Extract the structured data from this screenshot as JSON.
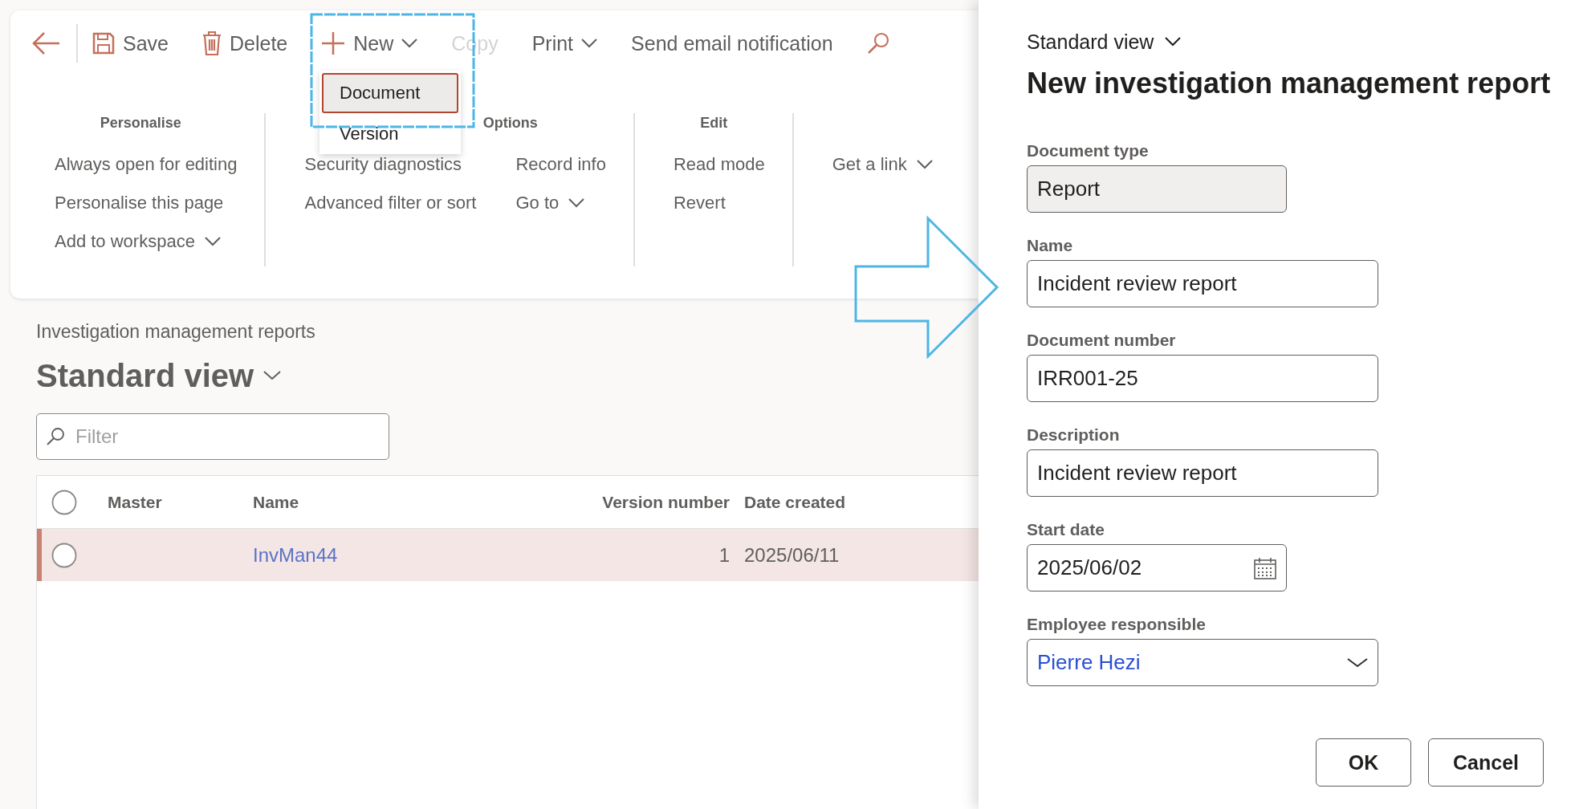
{
  "toolbar": {
    "items": [
      {
        "kind": "back",
        "disabled": false
      },
      {
        "kind": "save",
        "label": "Save",
        "disabled": false
      },
      {
        "kind": "delete",
        "label": "Delete",
        "disabled": false
      },
      {
        "kind": "new",
        "label": "New",
        "dropdown": true,
        "disabled": false
      },
      {
        "kind": "plain",
        "label": "Copy",
        "dropdown": false,
        "disabled": true
      },
      {
        "kind": "plain",
        "label": "Print",
        "dropdown": true,
        "disabled": false
      },
      {
        "kind": "plain",
        "label": "Send email notification",
        "dropdown": false,
        "disabled": false
      },
      {
        "kind": "search",
        "disabled": false
      }
    ]
  },
  "ribbon": {
    "groups": [
      {
        "title": "Personalise",
        "columns": [
          [
            {
              "label": "Always open for editing",
              "dropdown": false
            },
            {
              "label": "Personalise this page",
              "dropdown": false
            },
            {
              "label": "Add to workspace",
              "dropdown": true
            }
          ]
        ]
      },
      {
        "title": "Options",
        "columns": [
          [
            {
              "label": "Security diagnostics",
              "dropdown": false
            },
            {
              "label": "Advanced filter or sort",
              "dropdown": false
            }
          ],
          [
            {
              "label": "Record info",
              "dropdown": false
            },
            {
              "label": "Go to",
              "dropdown": true
            }
          ]
        ]
      },
      {
        "title": "Edit",
        "columns": [
          [
            {
              "label": "Read mode",
              "dropdown": false
            },
            {
              "label": "Revert",
              "dropdown": false
            }
          ]
        ]
      },
      {
        "columns": [
          [
            {
              "label": "Get a link",
              "dropdown": true
            }
          ]
        ]
      }
    ]
  },
  "new_menu": {
    "items": [
      {
        "label": "Document",
        "selected": true
      },
      {
        "label": "Version",
        "selected": false
      }
    ]
  },
  "list_page": {
    "breadcrumb": "Investigation management reports",
    "view": "Standard view",
    "filter": {
      "placeholder": "Filter"
    }
  },
  "grid": {
    "all_checked": false,
    "columns": [
      "Master",
      "Name",
      "Version number",
      "Date created"
    ],
    "rows": [
      {
        "name": "InvMan44",
        "version_number": "1",
        "date_created": "2025/06/11",
        "selected": true,
        "checked": false
      }
    ]
  },
  "dialog": {
    "view": "Standard view",
    "title": "New investigation management report",
    "fields": [
      {
        "kind": "text",
        "label": "Document type",
        "value": "Report",
        "readonly": true
      },
      {
        "kind": "text",
        "label": "Name",
        "value": "Incident review report",
        "readonly": false
      },
      {
        "kind": "text",
        "label": "Document number",
        "value": "IRR001-25",
        "readonly": false
      },
      {
        "kind": "text",
        "label": "Description",
        "value": "Incident review report",
        "readonly": false
      },
      {
        "kind": "date",
        "label": "Start date",
        "value": "2025/06/02",
        "readonly": false
      },
      {
        "kind": "lookup",
        "label": "Employee responsible",
        "value": "Pierre Hezi",
        "readonly": false
      }
    ],
    "buttons": [
      "OK",
      "Cancel"
    ]
  }
}
